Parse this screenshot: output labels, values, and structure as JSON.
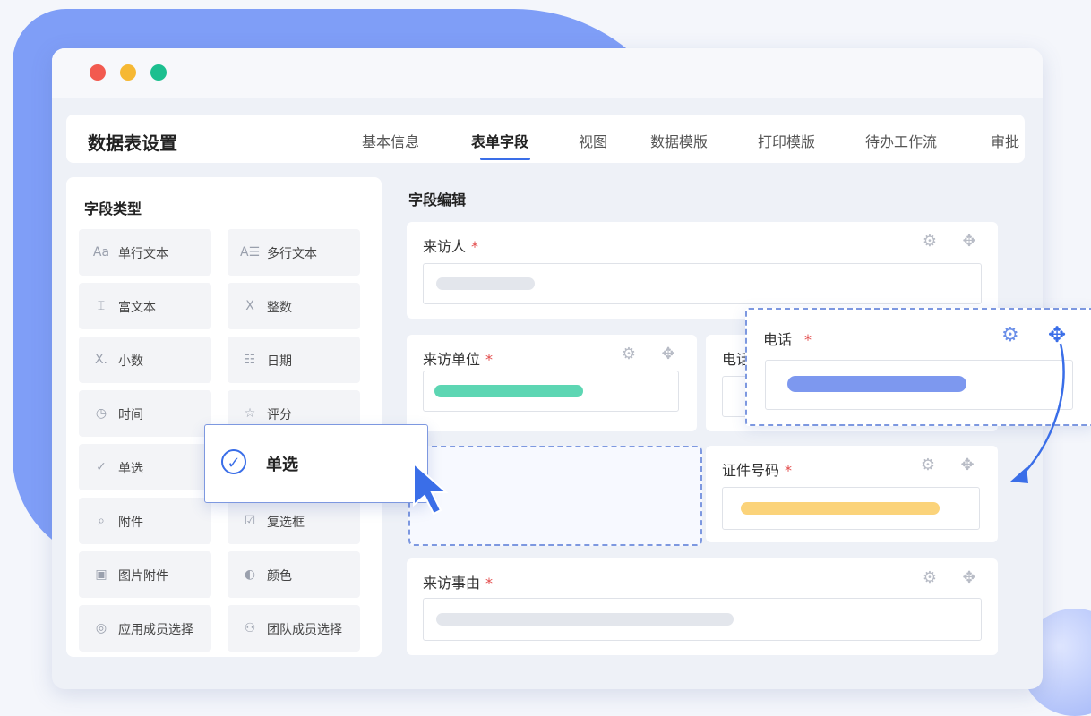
{
  "header": {
    "title": "数据表设置",
    "tabs": [
      "基本信息",
      "表单字段",
      "视图",
      "数据模版",
      "打印模版",
      "待办工作流",
      "审批"
    ],
    "active_tab": "表单字段"
  },
  "sidebar": {
    "heading": "字段类型",
    "items": [
      {
        "icon": "Aa",
        "label": "单行文本",
        "icon_name": "single-line-text-icon"
      },
      {
        "icon": "A☰",
        "label": "多行文本",
        "icon_name": "multi-line-text-icon"
      },
      {
        "icon": "⌶",
        "label": "富文本",
        "icon_name": "rich-text-icon"
      },
      {
        "icon": "X",
        "label": "整数",
        "icon_name": "integer-icon"
      },
      {
        "icon": "X.",
        "label": "小数",
        "icon_name": "decimal-icon"
      },
      {
        "icon": "☷",
        "label": "日期",
        "icon_name": "date-icon"
      },
      {
        "icon": "◷",
        "label": "时间",
        "icon_name": "time-icon"
      },
      {
        "icon": "☆",
        "label": "评分",
        "icon_name": "rating-icon"
      },
      {
        "icon": "✓",
        "label": "单选",
        "icon_name": "single-select-icon"
      },
      {
        "icon": "☐",
        "label": "",
        "icon_name": "hidden-icon"
      },
      {
        "icon": "⌕",
        "label": "附件",
        "icon_name": "attachment-icon"
      },
      {
        "icon": "☑",
        "label": "复选框",
        "icon_name": "checkbox-icon"
      },
      {
        "icon": "▣",
        "label": "图片附件",
        "icon_name": "image-attachment-icon"
      },
      {
        "icon": "◐",
        "label": "颜色",
        "icon_name": "color-icon"
      },
      {
        "icon": "◎",
        "label": "应用成员选择",
        "icon_name": "app-member-icon"
      },
      {
        "icon": "⚇",
        "label": "团队成员选择",
        "icon_name": "team-member-icon"
      }
    ]
  },
  "editor": {
    "title": "字段编辑",
    "fields": {
      "visitor": "来访人",
      "unit": "来访单位",
      "phone_partial": "电话",
      "id_number": "证件号码",
      "reason": "来访事由"
    },
    "required_mark": "*"
  },
  "drag_card": {
    "label": "电话",
    "required_mark": "*"
  },
  "drag_item": {
    "label": "单选"
  },
  "colors": {
    "accent": "#3a6ee8",
    "green_pill": "#5dd6b3",
    "yellow_pill": "#fbd37a",
    "blue_pill": "#7d98ef",
    "gray_pill": "#e3e6ec"
  }
}
